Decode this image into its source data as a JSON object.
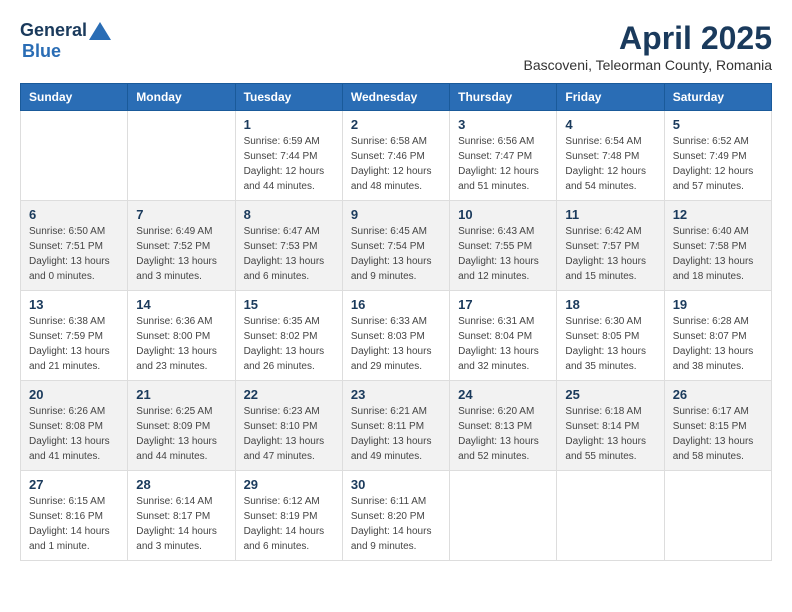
{
  "header": {
    "logo_general": "General",
    "logo_blue": "Blue",
    "month": "April 2025",
    "location": "Bascoveni, Teleorman County, Romania"
  },
  "weekdays": [
    "Sunday",
    "Monday",
    "Tuesday",
    "Wednesday",
    "Thursday",
    "Friday",
    "Saturday"
  ],
  "weeks": [
    [
      {
        "day": "",
        "info": ""
      },
      {
        "day": "",
        "info": ""
      },
      {
        "day": "1",
        "info": "Sunrise: 6:59 AM\nSunset: 7:44 PM\nDaylight: 12 hours\nand 44 minutes."
      },
      {
        "day": "2",
        "info": "Sunrise: 6:58 AM\nSunset: 7:46 PM\nDaylight: 12 hours\nand 48 minutes."
      },
      {
        "day": "3",
        "info": "Sunrise: 6:56 AM\nSunset: 7:47 PM\nDaylight: 12 hours\nand 51 minutes."
      },
      {
        "day": "4",
        "info": "Sunrise: 6:54 AM\nSunset: 7:48 PM\nDaylight: 12 hours\nand 54 minutes."
      },
      {
        "day": "5",
        "info": "Sunrise: 6:52 AM\nSunset: 7:49 PM\nDaylight: 12 hours\nand 57 minutes."
      }
    ],
    [
      {
        "day": "6",
        "info": "Sunrise: 6:50 AM\nSunset: 7:51 PM\nDaylight: 13 hours\nand 0 minutes."
      },
      {
        "day": "7",
        "info": "Sunrise: 6:49 AM\nSunset: 7:52 PM\nDaylight: 13 hours\nand 3 minutes."
      },
      {
        "day": "8",
        "info": "Sunrise: 6:47 AM\nSunset: 7:53 PM\nDaylight: 13 hours\nand 6 minutes."
      },
      {
        "day": "9",
        "info": "Sunrise: 6:45 AM\nSunset: 7:54 PM\nDaylight: 13 hours\nand 9 minutes."
      },
      {
        "day": "10",
        "info": "Sunrise: 6:43 AM\nSunset: 7:55 PM\nDaylight: 13 hours\nand 12 minutes."
      },
      {
        "day": "11",
        "info": "Sunrise: 6:42 AM\nSunset: 7:57 PM\nDaylight: 13 hours\nand 15 minutes."
      },
      {
        "day": "12",
        "info": "Sunrise: 6:40 AM\nSunset: 7:58 PM\nDaylight: 13 hours\nand 18 minutes."
      }
    ],
    [
      {
        "day": "13",
        "info": "Sunrise: 6:38 AM\nSunset: 7:59 PM\nDaylight: 13 hours\nand 21 minutes."
      },
      {
        "day": "14",
        "info": "Sunrise: 6:36 AM\nSunset: 8:00 PM\nDaylight: 13 hours\nand 23 minutes."
      },
      {
        "day": "15",
        "info": "Sunrise: 6:35 AM\nSunset: 8:02 PM\nDaylight: 13 hours\nand 26 minutes."
      },
      {
        "day": "16",
        "info": "Sunrise: 6:33 AM\nSunset: 8:03 PM\nDaylight: 13 hours\nand 29 minutes."
      },
      {
        "day": "17",
        "info": "Sunrise: 6:31 AM\nSunset: 8:04 PM\nDaylight: 13 hours\nand 32 minutes."
      },
      {
        "day": "18",
        "info": "Sunrise: 6:30 AM\nSunset: 8:05 PM\nDaylight: 13 hours\nand 35 minutes."
      },
      {
        "day": "19",
        "info": "Sunrise: 6:28 AM\nSunset: 8:07 PM\nDaylight: 13 hours\nand 38 minutes."
      }
    ],
    [
      {
        "day": "20",
        "info": "Sunrise: 6:26 AM\nSunset: 8:08 PM\nDaylight: 13 hours\nand 41 minutes."
      },
      {
        "day": "21",
        "info": "Sunrise: 6:25 AM\nSunset: 8:09 PM\nDaylight: 13 hours\nand 44 minutes."
      },
      {
        "day": "22",
        "info": "Sunrise: 6:23 AM\nSunset: 8:10 PM\nDaylight: 13 hours\nand 47 minutes."
      },
      {
        "day": "23",
        "info": "Sunrise: 6:21 AM\nSunset: 8:11 PM\nDaylight: 13 hours\nand 49 minutes."
      },
      {
        "day": "24",
        "info": "Sunrise: 6:20 AM\nSunset: 8:13 PM\nDaylight: 13 hours\nand 52 minutes."
      },
      {
        "day": "25",
        "info": "Sunrise: 6:18 AM\nSunset: 8:14 PM\nDaylight: 13 hours\nand 55 minutes."
      },
      {
        "day": "26",
        "info": "Sunrise: 6:17 AM\nSunset: 8:15 PM\nDaylight: 13 hours\nand 58 minutes."
      }
    ],
    [
      {
        "day": "27",
        "info": "Sunrise: 6:15 AM\nSunset: 8:16 PM\nDaylight: 14 hours\nand 1 minute."
      },
      {
        "day": "28",
        "info": "Sunrise: 6:14 AM\nSunset: 8:17 PM\nDaylight: 14 hours\nand 3 minutes."
      },
      {
        "day": "29",
        "info": "Sunrise: 6:12 AM\nSunset: 8:19 PM\nDaylight: 14 hours\nand 6 minutes."
      },
      {
        "day": "30",
        "info": "Sunrise: 6:11 AM\nSunset: 8:20 PM\nDaylight: 14 hours\nand 9 minutes."
      },
      {
        "day": "",
        "info": ""
      },
      {
        "day": "",
        "info": ""
      },
      {
        "day": "",
        "info": ""
      }
    ]
  ]
}
